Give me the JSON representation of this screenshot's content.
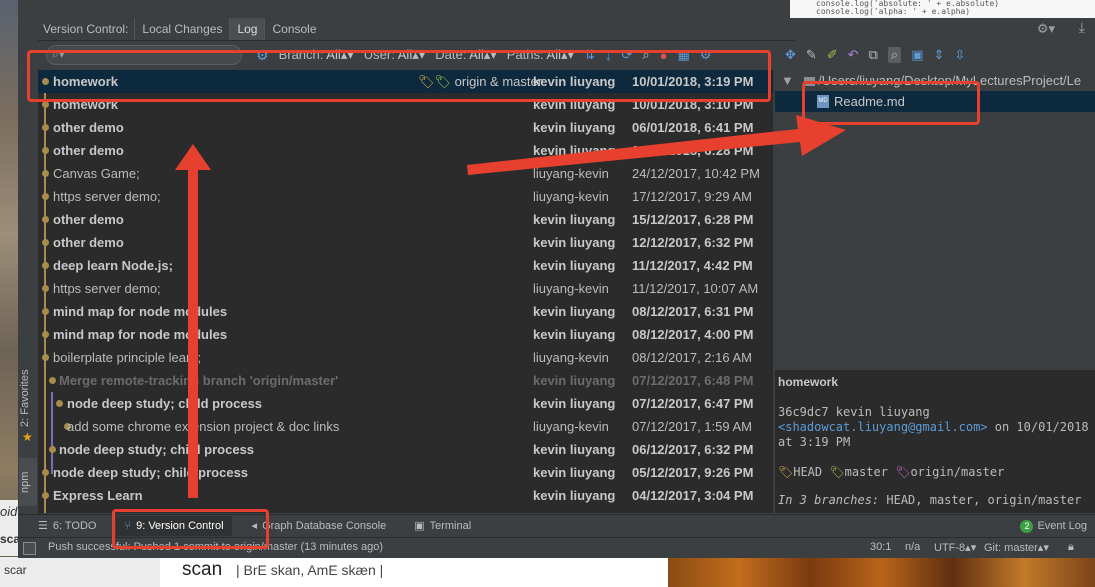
{
  "background": {
    "code_lines": [
      "console.log('absolute: ' + e.absolute)",
      "console.log('alpha: ' + e.alpha)"
    ],
    "dictionary_word": "scan",
    "dictionary_pron": "| BrE skan, AmE skæn |",
    "left_word": "scar",
    "left_partial_1": "oid",
    "left_partial_2": "sca"
  },
  "tool_window": {
    "title": "Version Control:",
    "tabs": [
      "Local Changes",
      "Log",
      "Console"
    ],
    "active_tab": 1
  },
  "toolbar": {
    "search_placeholder": "",
    "filters": [
      {
        "label": "Branch:",
        "value": "All"
      },
      {
        "label": "User:",
        "value": "All"
      },
      {
        "label": "Date:",
        "value": "All"
      },
      {
        "label": "Paths:",
        "value": "All"
      }
    ],
    "icons": [
      "collapse-linear-branches-icon",
      "intellisort-icon",
      "refresh-icon",
      "find-icon",
      "cherry-pick-icon",
      "columns-icon",
      "settings-icon"
    ]
  },
  "commits": [
    {
      "message": "homework",
      "refs": "origin & master",
      "author": "kevin liuyang",
      "date": "10/01/2018, 3:19 PM",
      "style": "bold",
      "selected": true,
      "indent": 0
    },
    {
      "message": "homework",
      "refs": "",
      "author": "kevin liuyang",
      "date": "10/01/2018, 3:10 PM",
      "style": "bold",
      "selected": false,
      "indent": 0
    },
    {
      "message": "other demo",
      "refs": "",
      "author": "kevin liuyang",
      "date": "06/01/2018, 6:41 PM",
      "style": "bold",
      "selected": false,
      "indent": 0
    },
    {
      "message": "other demo",
      "refs": "",
      "author": "kevin liuyang",
      "date": "06/01/2018, 6:28 PM",
      "style": "bold",
      "selected": false,
      "indent": 0
    },
    {
      "message": "Canvas Game;",
      "refs": "",
      "author": "liuyang-kevin",
      "date": "24/12/2017, 10:42 PM",
      "style": "normal",
      "selected": false,
      "indent": 0
    },
    {
      "message": "https server demo;",
      "refs": "",
      "author": "liuyang-kevin",
      "date": "17/12/2017, 9:29 AM",
      "style": "normal",
      "selected": false,
      "indent": 0
    },
    {
      "message": "other demo",
      "refs": "",
      "author": "kevin liuyang",
      "date": "15/12/2017, 6:28 PM",
      "style": "bold",
      "selected": false,
      "indent": 0
    },
    {
      "message": "other demo",
      "refs": "",
      "author": "kevin liuyang",
      "date": "12/12/2017, 6:32 PM",
      "style": "bold",
      "selected": false,
      "indent": 0
    },
    {
      "message": "deep learn Node.js;",
      "refs": "",
      "author": "kevin liuyang",
      "date": "11/12/2017, 4:42 PM",
      "style": "bold",
      "selected": false,
      "indent": 0
    },
    {
      "message": "https server demo;",
      "refs": "",
      "author": "liuyang-kevin",
      "date": "11/12/2017, 10:07 AM",
      "style": "normal",
      "selected": false,
      "indent": 0
    },
    {
      "message": "mind map for node modules",
      "refs": "",
      "author": "kevin liuyang",
      "date": "08/12/2017, 6:31 PM",
      "style": "bold",
      "selected": false,
      "indent": 0
    },
    {
      "message": "mind map for node modules",
      "refs": "",
      "author": "kevin liuyang",
      "date": "08/12/2017, 4:00 PM",
      "style": "bold",
      "selected": false,
      "indent": 0
    },
    {
      "message": "boilerplate principle learn;",
      "refs": "",
      "author": "liuyang-kevin",
      "date": "08/12/2017, 2:16 AM",
      "style": "normal",
      "selected": false,
      "indent": 0
    },
    {
      "message": "Merge remote-tracking branch 'origin/master'",
      "refs": "",
      "author": "kevin liuyang",
      "date": "07/12/2017, 6:48 PM",
      "style": "dim",
      "selected": false,
      "indent": 1
    },
    {
      "message": "node deep study; child process",
      "refs": "",
      "author": "kevin liuyang",
      "date": "07/12/2017, 6:47 PM",
      "style": "bold",
      "selected": false,
      "indent": 2
    },
    {
      "message": "add some chrome extension project & doc links",
      "refs": "",
      "author": "liuyang-kevin",
      "date": "07/12/2017, 1:59 AM",
      "style": "normal",
      "selected": false,
      "indent": 3
    },
    {
      "message": "node deep study; child process",
      "refs": "",
      "author": "kevin liuyang",
      "date": "06/12/2017, 6:32 PM",
      "style": "bold",
      "selected": false,
      "indent": 1
    },
    {
      "message": "node deep study; child process",
      "refs": "",
      "author": "kevin liuyang",
      "date": "05/12/2017, 9:26 PM",
      "style": "bold",
      "selected": false,
      "indent": 0
    },
    {
      "message": "Express Learn",
      "refs": "",
      "author": "kevin liuyang",
      "date": "04/12/2017, 3:04 PM",
      "style": "bold",
      "selected": false,
      "indent": 0
    }
  ],
  "changes_tree": {
    "root": "/Users/liuyang/Desktop/MyLecturesProject/Le",
    "file": "Readme.md",
    "file_icon_text": "MD"
  },
  "commit_details": {
    "subject": "homework",
    "line1": "36c9dc7 kevin liuyang",
    "email": "<shadowcat.liuyang@gmail.com>",
    "on_text": " on 10/01/2018",
    "line3": "at 3:19 PM",
    "tags": [
      "HEAD",
      "master",
      "origin/master"
    ],
    "branches_label": "In 3 branches:",
    "branches_value": " HEAD, master, origin/master"
  },
  "side_tabs": {
    "favorites": "2: Favorites",
    "npm": "npm"
  },
  "bottom_tabs": [
    {
      "label": "6: TODO",
      "active": false
    },
    {
      "label": "9: Version Control",
      "active": true
    },
    {
      "label": "Graph Database Console",
      "active": false
    },
    {
      "label": "Terminal",
      "active": false
    }
  ],
  "event_log": {
    "badge": "2",
    "label": "Event Log"
  },
  "status_bar": {
    "message": "Push successful: Pushed 1 commit to origin/master (13 minutes ago)",
    "position": "30:1",
    "na": "n/a",
    "encoding": "UTF-8",
    "branch": "Git: master"
  },
  "colors": {
    "annotation": "#e8402e",
    "selection": "#0d293e",
    "graph": "#a88c4c",
    "link": "#5c9bd6"
  }
}
